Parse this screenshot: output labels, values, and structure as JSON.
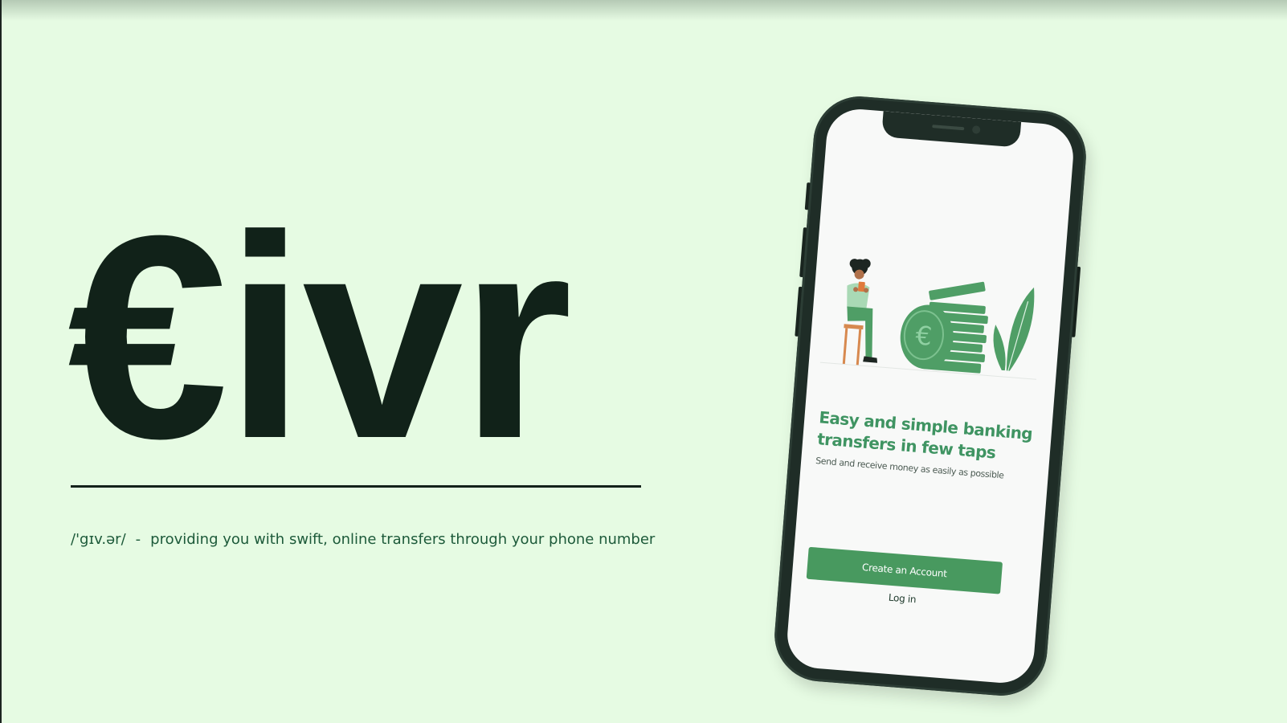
{
  "brand": {
    "wordmark": "€ivr",
    "phonetic": "/'gɪv.ər/",
    "separator": "-",
    "tagline": "providing you with swift, online transfers through your phone number"
  },
  "phone_screen": {
    "headline": "Easy and simple banking transfers in few taps",
    "subline": "Send and receive money as easily as possible",
    "primary_button": "Create an Account",
    "secondary_link": "Log in",
    "illustration": {
      "icons": [
        "person-drinking-icon",
        "euro-coin-icon",
        "coin-stack-icon",
        "plant-icon"
      ]
    }
  },
  "colors": {
    "background": "#e6fbe3",
    "wordmark": "#112219",
    "accent_green": "#48995f",
    "phone_frame": "#1f2d27"
  }
}
